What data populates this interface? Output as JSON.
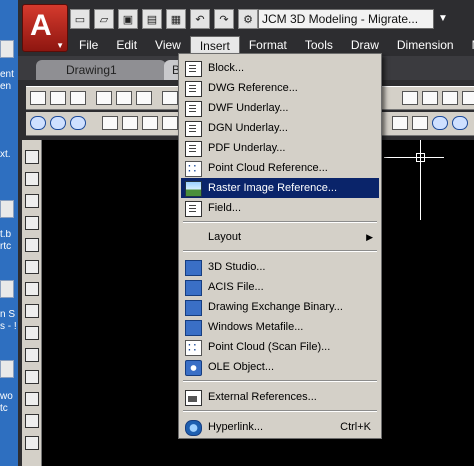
{
  "desktop": {
    "labels": [
      "ent",
      "en",
      "xt.",
      "t.b",
      "rtc",
      "n S",
      "s - !",
      "wo",
      "tc"
    ]
  },
  "app": {
    "workspace": "JCM 3D Modeling - Migrate...",
    "menubar": [
      "File",
      "Edit",
      "View",
      "Insert",
      "Format",
      "Tools",
      "Draw",
      "Dimension",
      "Mod"
    ],
    "active_menu": "Insert",
    "tabs": [
      "Drawing1",
      "B"
    ]
  },
  "insert_menu": {
    "items": [
      {
        "label": "Block...",
        "icon": "block-icon"
      },
      {
        "label": "DWG Reference...",
        "icon": "dwg-reference-icon"
      },
      {
        "label": "DWF Underlay...",
        "icon": "dwf-underlay-icon"
      },
      {
        "label": "DGN Underlay...",
        "icon": "dgn-underlay-icon"
      },
      {
        "label": "PDF Underlay...",
        "icon": "pdf-underlay-icon"
      },
      {
        "label": "Point Cloud Reference...",
        "icon": "point-cloud-icon"
      },
      {
        "label": "Raster Image Reference...",
        "icon": "raster-image-icon",
        "highlighted": true
      },
      {
        "label": "Field...",
        "icon": "field-icon"
      },
      {
        "label": "Layout",
        "submenu": true
      },
      {
        "label": "3D Studio...",
        "icon": "3d-studio-icon"
      },
      {
        "label": "ACIS File...",
        "icon": "acis-file-icon"
      },
      {
        "label": "Drawing Exchange Binary...",
        "icon": "dxb-icon"
      },
      {
        "label": "Windows Metafile...",
        "icon": "metafile-icon"
      },
      {
        "label": "Point Cloud (Scan File)...",
        "icon": "scan-file-icon"
      },
      {
        "label": "OLE Object...",
        "icon": "ole-object-icon"
      },
      {
        "label": "External References...",
        "icon": "external-references-icon"
      },
      {
        "label": "Hyperlink...",
        "icon": "hyperlink-icon",
        "shortcut": "Ctrl+K"
      }
    ],
    "submenu_arrow": "▶"
  },
  "colors": {
    "highlight": "#0a246a",
    "menu_bg": "#d4d0c8",
    "app_button": "#c8281c"
  }
}
